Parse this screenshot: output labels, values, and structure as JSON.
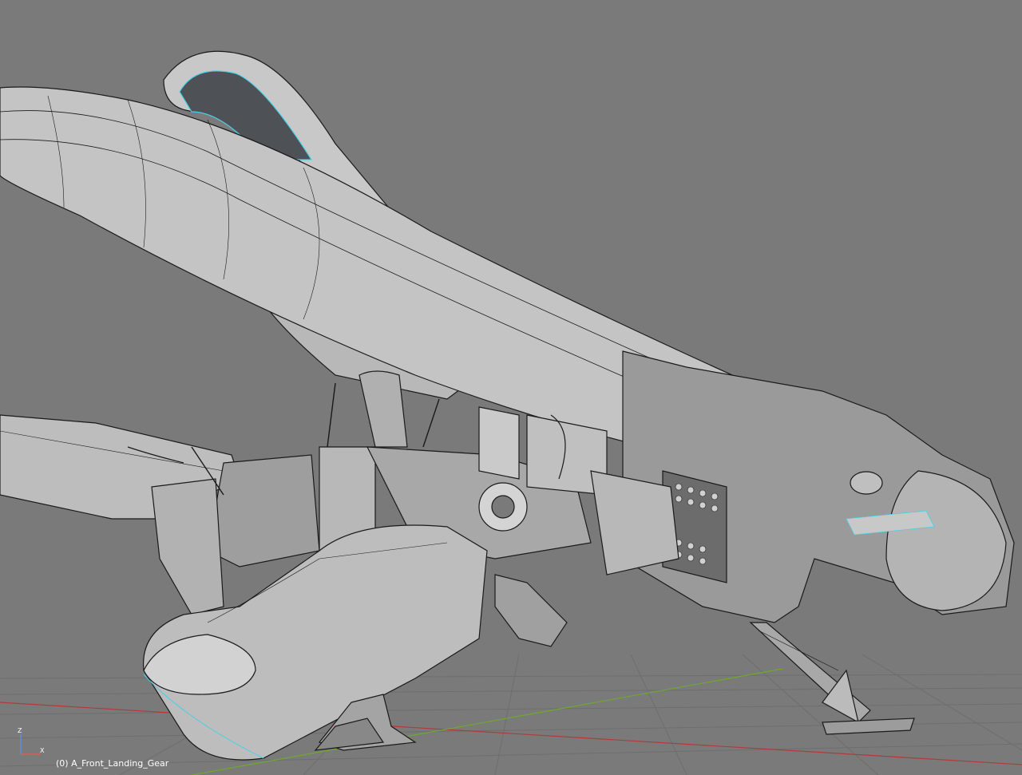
{
  "viewport": {
    "background_color": "#7a7a7a",
    "mesh_fill": "#c8c8c8",
    "mesh_shadow": "#8e8e8e",
    "wire_color": "#1a1a1a",
    "selection_color": "#47d0e8",
    "grid_color": "#6e6e6e",
    "x_axis_color": "#b33a3a",
    "y_axis_color": "#6fa82f"
  },
  "status": {
    "object_label": "(0) A_Front_Landing_Gear"
  },
  "axis_gizmo": {
    "z_label": "Z",
    "x_label": "X",
    "z_color": "#5a8ee6",
    "x_color": "#e05a5a"
  }
}
